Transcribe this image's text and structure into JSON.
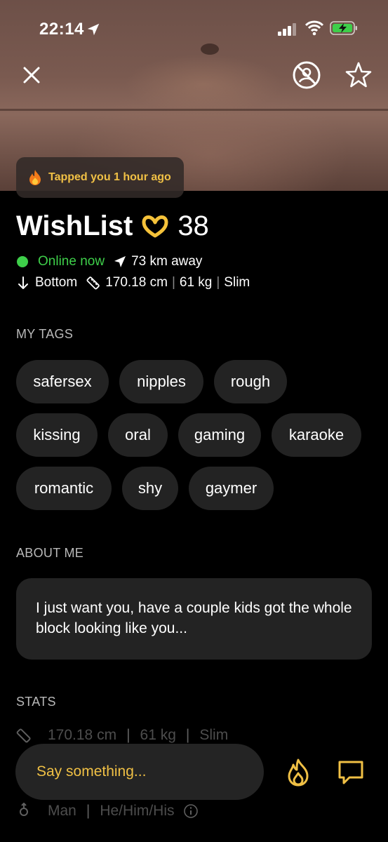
{
  "status_bar": {
    "time": "22:14",
    "icons": [
      "location-arrow-icon",
      "signal-icon",
      "wifi-icon",
      "battery-charging-icon"
    ]
  },
  "header": {
    "icons": [
      "close-icon",
      "block-user-icon",
      "star-icon"
    ]
  },
  "tap_badge": {
    "icon": "fire-icon",
    "text": "Tapped you 1 hour ago"
  },
  "profile": {
    "name": "WishList",
    "emoji": "heart-hands-emoji",
    "age": "38",
    "online": "Online now",
    "distance": "73 km away",
    "position": "Bottom",
    "height": "170.18 cm",
    "weight": "61 kg",
    "body_type": "Slim"
  },
  "tags_section": {
    "title": "MY TAGS",
    "tags": [
      "safersex",
      "nipples",
      "rough",
      "kissing",
      "oral",
      "gaming",
      "karaoke",
      "romantic",
      "shy",
      "gaymer"
    ]
  },
  "about_section": {
    "title": "ABOUT ME",
    "text": "I just want you, have a couple kids got the whole block looking like you..."
  },
  "stats_section": {
    "title": "STATS",
    "height": "170.18 cm",
    "weight": "61 kg",
    "body_type": "Slim",
    "gender": "Man",
    "pronouns": "He/Him/His"
  },
  "chat": {
    "placeholder": "Say something...",
    "tap_icon": "fire-icon",
    "message_icon": "chat-bubble-icon"
  },
  "colors": {
    "accent_yellow": "#f0c045",
    "online_green": "#3ecf4a",
    "card_bg": "#232323"
  }
}
